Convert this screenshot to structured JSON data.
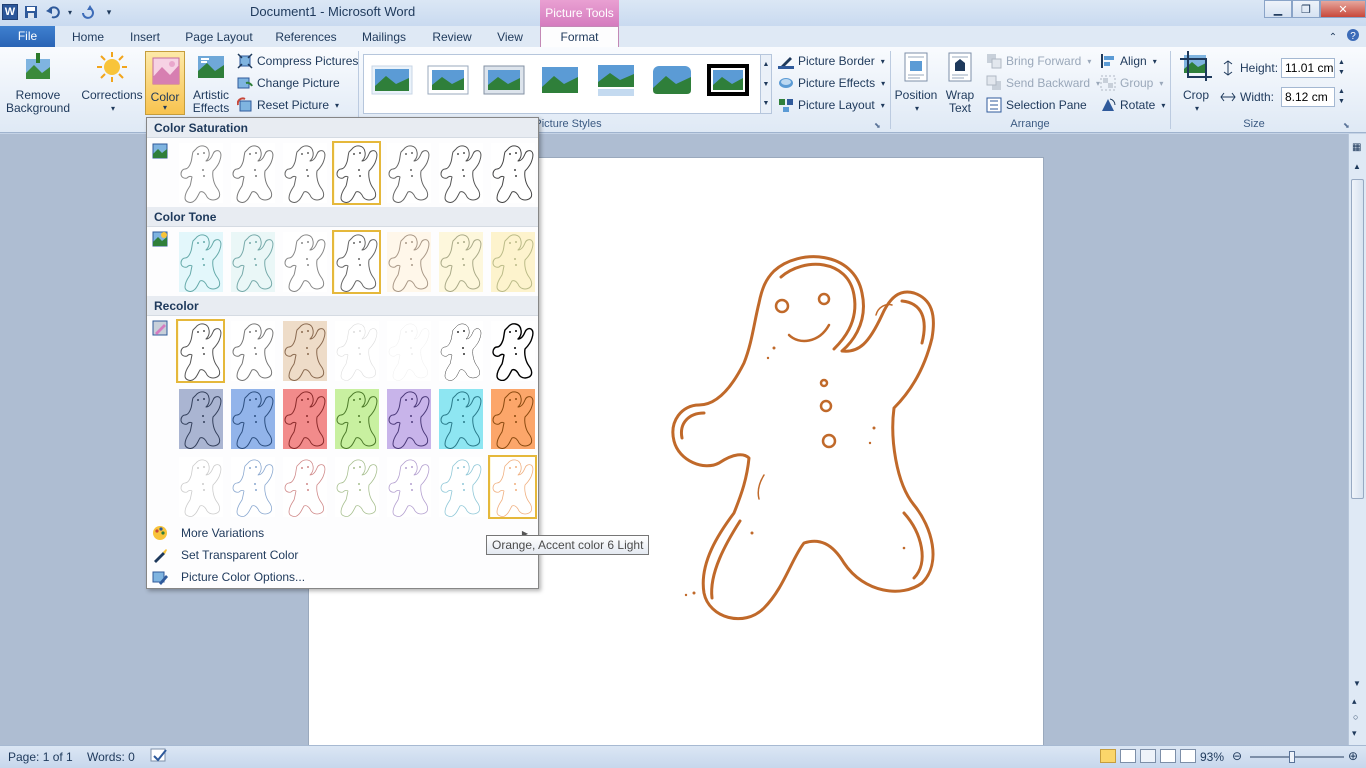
{
  "window": {
    "title": "Document1  -  Microsoft Word",
    "app_icon": "W"
  },
  "contextual_tab": "Picture Tools",
  "tabs": [
    "File",
    "Home",
    "Insert",
    "Page Layout",
    "References",
    "Mailings",
    "Review",
    "View",
    "Format"
  ],
  "ribbon": {
    "adjust": {
      "remove_background": "Remove Background",
      "corrections": "Corrections",
      "color": "Color",
      "artistic_effects": "Artistic Effects",
      "compress_pictures": "Compress Pictures",
      "change_picture": "Change Picture",
      "reset_picture": "Reset Picture"
    },
    "picture_styles": {
      "label": "Picture Styles",
      "picture_border": "Picture Border",
      "picture_effects": "Picture Effects",
      "picture_layout": "Picture Layout"
    },
    "arrange": {
      "label": "Arrange",
      "position": "Position",
      "wrap_text": "Wrap Text",
      "bring_forward": "Bring Forward",
      "send_backward": "Send Backward",
      "selection_pane": "Selection Pane",
      "align": "Align",
      "group": "Group",
      "rotate": "Rotate"
    },
    "size": {
      "label": "Size",
      "crop": "Crop",
      "height_label": "Height:",
      "height_value": "11.01 cm",
      "width_label": "Width:",
      "width_value": "8.12 cm"
    }
  },
  "color_menu": {
    "color_saturation": "Color Saturation",
    "color_tone": "Color Tone",
    "recolor": "Recolor",
    "more_variations": "More Variations",
    "set_transparent_color": "Set Transparent Color",
    "picture_color_options": "Picture Color Options...",
    "tooltip": "Orange, Accent color 6 Light"
  },
  "status": {
    "page": "Page: 1 of 1",
    "words": "Words: 0",
    "zoom": "93%"
  },
  "colors": {
    "gingerbread_outline": "#c0692a",
    "accent_orange": "#f79646",
    "selection_border": "#e5b83b"
  }
}
